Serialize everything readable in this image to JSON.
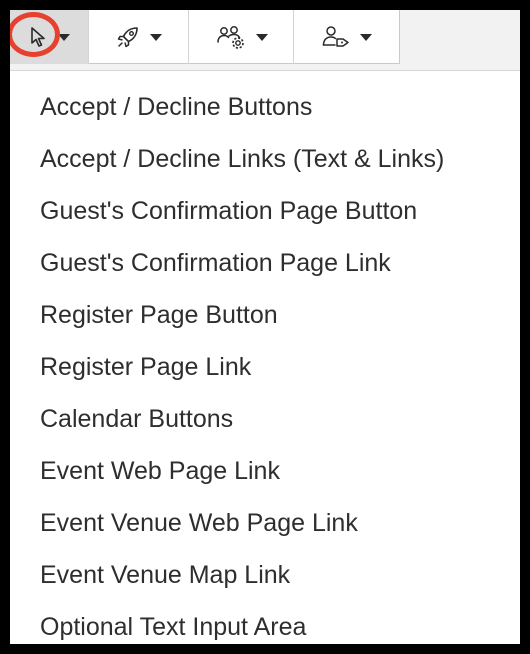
{
  "toolbar": {
    "buttons": [
      {
        "id": "pointer",
        "icon": "cursor-icon",
        "active": true,
        "highlighted": true,
        "caret": "caret-down-icon"
      },
      {
        "id": "launch",
        "icon": "rocket-icon",
        "active": false,
        "caret": "caret-down-icon"
      },
      {
        "id": "group-settings",
        "icon": "users-settings-icon",
        "active": false,
        "caret": "caret-down-icon"
      },
      {
        "id": "user-tag",
        "icon": "user-tag-icon",
        "active": false,
        "caret": "caret-down-icon"
      }
    ],
    "highlight_color": "#e8402e"
  },
  "menu": {
    "items": [
      "Accept / Decline Buttons",
      "Accept / Decline Links (Text & Links)",
      "Guest's Confirmation Page Button",
      "Guest's Confirmation Page Link",
      "Register Page Button",
      "Register Page Link",
      "Calendar Buttons",
      "Event Web Page Link",
      "Event Venue Web Page Link",
      "Event Venue Map Link",
      "Optional Text Input Area"
    ]
  },
  "colors": {
    "frame": "#000000",
    "menu_text": "#2e2e2e",
    "active_button_bg": "#dcdcdc"
  }
}
